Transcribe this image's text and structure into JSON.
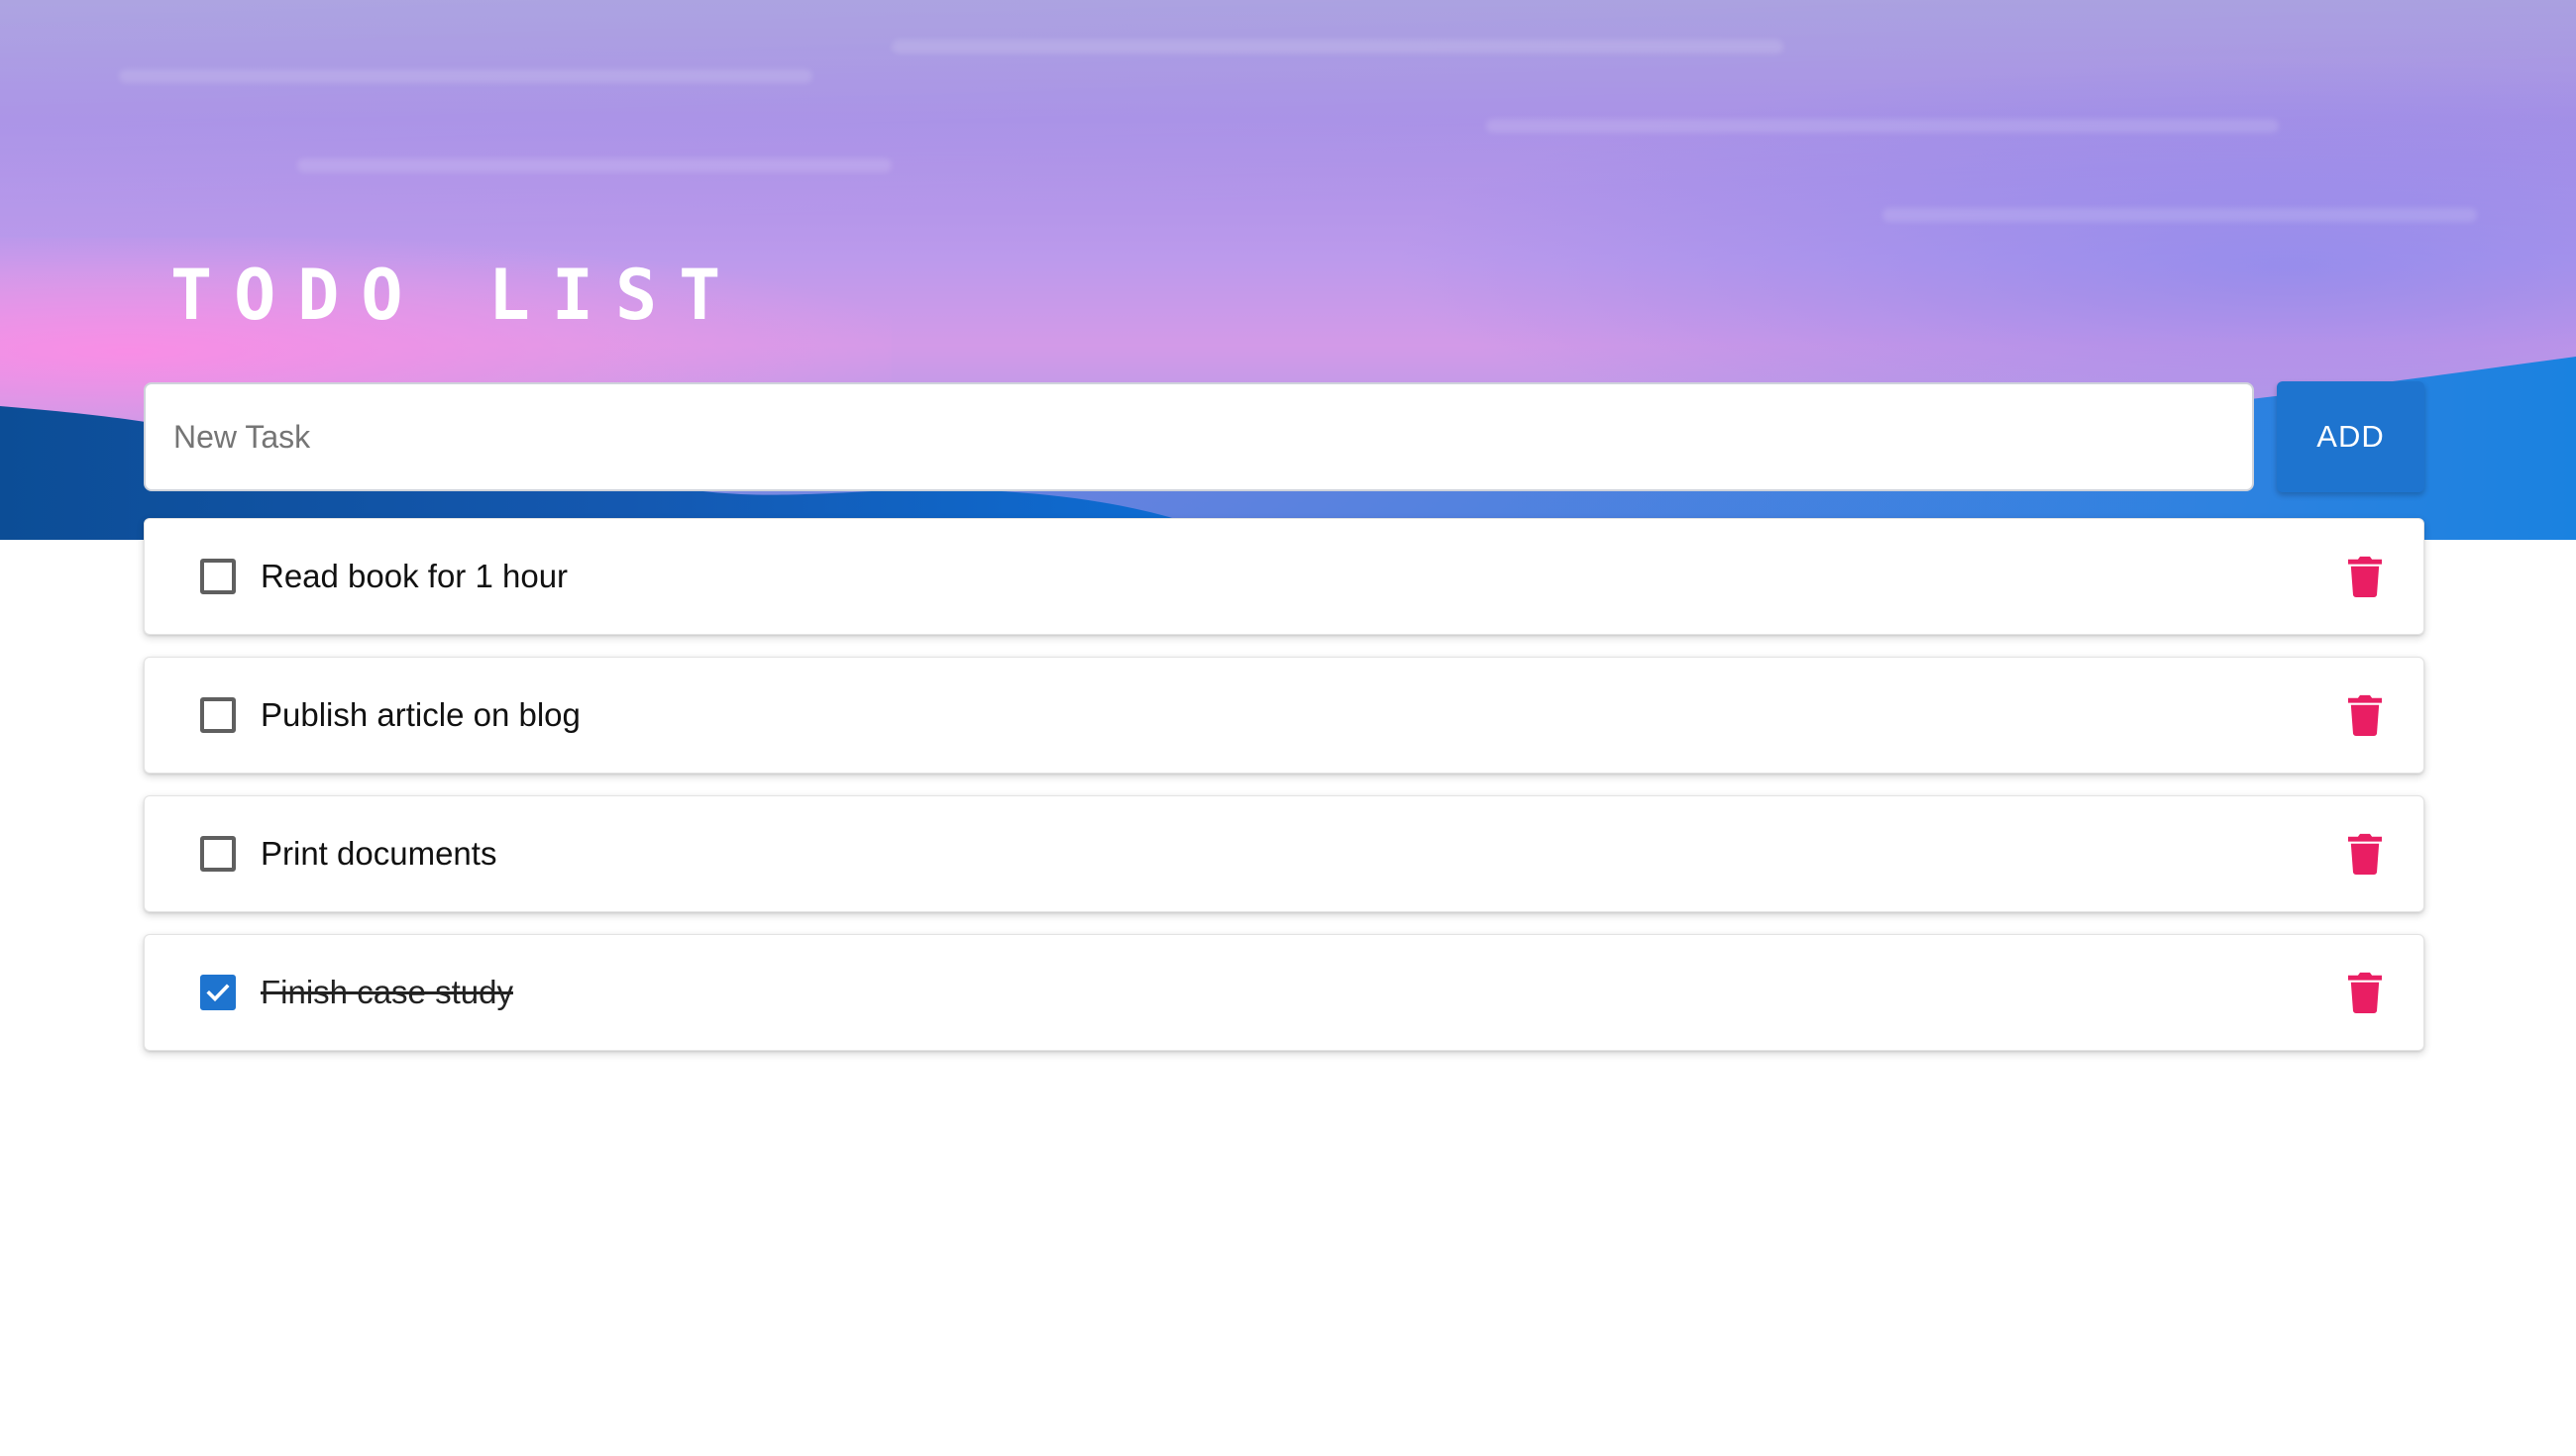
{
  "app": {
    "title": "TODO LIST"
  },
  "new_task": {
    "placeholder": "New Task",
    "value": ""
  },
  "add_button": {
    "label": "ADD"
  },
  "tasks": [
    {
      "label": "Read book for 1 hour",
      "completed": false
    },
    {
      "label": "Publish article on blog",
      "completed": false
    },
    {
      "label": "Print documents",
      "completed": false
    },
    {
      "label": "Finish case study",
      "completed": true
    }
  ],
  "icons": {
    "checkbox": "checkbox-icon",
    "delete": "trash-icon"
  },
  "colors": {
    "accent": "#1e74cf",
    "delete": "#e91e63",
    "checkbox_border": "#5f5f5f"
  }
}
